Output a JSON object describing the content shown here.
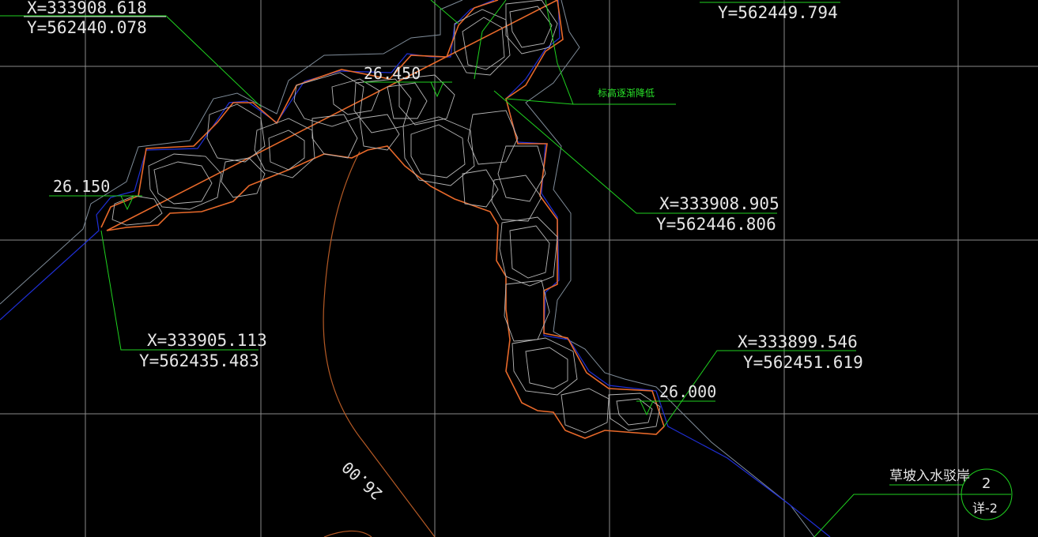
{
  "drawing": {
    "background": "#000000",
    "colors": {
      "grid": "#8a8a8a",
      "leader": "#1fd11f",
      "outline_orange": "#e8692a",
      "outline_blue": "#1f2fd6",
      "outline_gray": "#7f8c99",
      "rock": "#b5b5b5",
      "contour": "#b55a25",
      "text": "#e6e6e6"
    },
    "coordinates": [
      {
        "id": "c1",
        "x": "X=333908.618",
        "y": "Y=562440.078"
      },
      {
        "id": "c2",
        "x": "Y=562449.794",
        "y": ""
      },
      {
        "id": "c3",
        "x": "X=333908.905",
        "y": "Y=562446.806"
      },
      {
        "id": "c4",
        "x": "X=333905.113",
        "y": "Y=562435.483"
      },
      {
        "id": "c5",
        "x": "X=333899.546",
        "y": "Y=562451.619"
      }
    ],
    "elevations": [
      "26.450",
      "26.150",
      "26.000"
    ],
    "contour_label": "26.00",
    "note_label": "标高逐渐降低",
    "callout": {
      "text": "草坡入水驳岸",
      "number": "2",
      "ref": "详-2"
    }
  }
}
